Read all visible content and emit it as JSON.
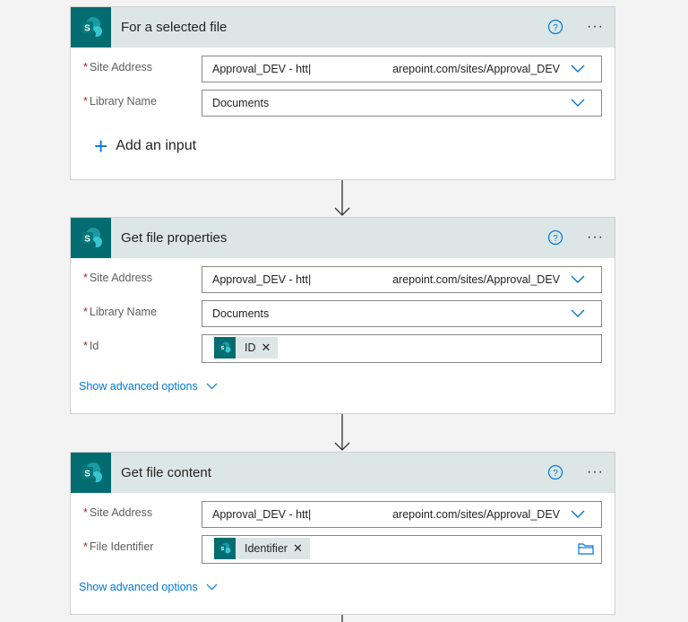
{
  "colors": {
    "brand": "#036c70",
    "link": "#0078d4",
    "header_bg": "#dde6e6",
    "required": "#a4262c"
  },
  "cards": [
    {
      "title": "For a selected file",
      "fields": [
        {
          "label": "Site Address",
          "value_left": "Approval_DEV - htt|",
          "value_right": "arepoint.com/sites/Approval_DEV"
        },
        {
          "label": "Library Name",
          "value": "Documents"
        }
      ],
      "add_input_label": "Add an input"
    },
    {
      "title": "Get file properties",
      "fields": [
        {
          "label": "Site Address",
          "value_left": "Approval_DEV - htt|",
          "value_right": "arepoint.com/sites/Approval_DEV"
        },
        {
          "label": "Library Name",
          "value": "Documents"
        },
        {
          "label": "Id",
          "token": "ID"
        }
      ],
      "advanced_label": "Show advanced options"
    },
    {
      "title": "Get file content",
      "fields": [
        {
          "label": "Site Address",
          "value_left": "Approval_DEV - htt|",
          "value_right": "arepoint.com/sites/Approval_DEV"
        },
        {
          "label": "File Identifier",
          "token": "Identifier"
        }
      ],
      "advanced_label": "Show advanced options"
    }
  ],
  "required_marker": "*",
  "more_label": "···",
  "token_remove": "✕",
  "icons": [
    "sharepoint-icon",
    "help-icon",
    "more-icon",
    "chevron-down-icon",
    "plus-icon",
    "folder-icon",
    "arrow-down-icon",
    "close-icon"
  ]
}
